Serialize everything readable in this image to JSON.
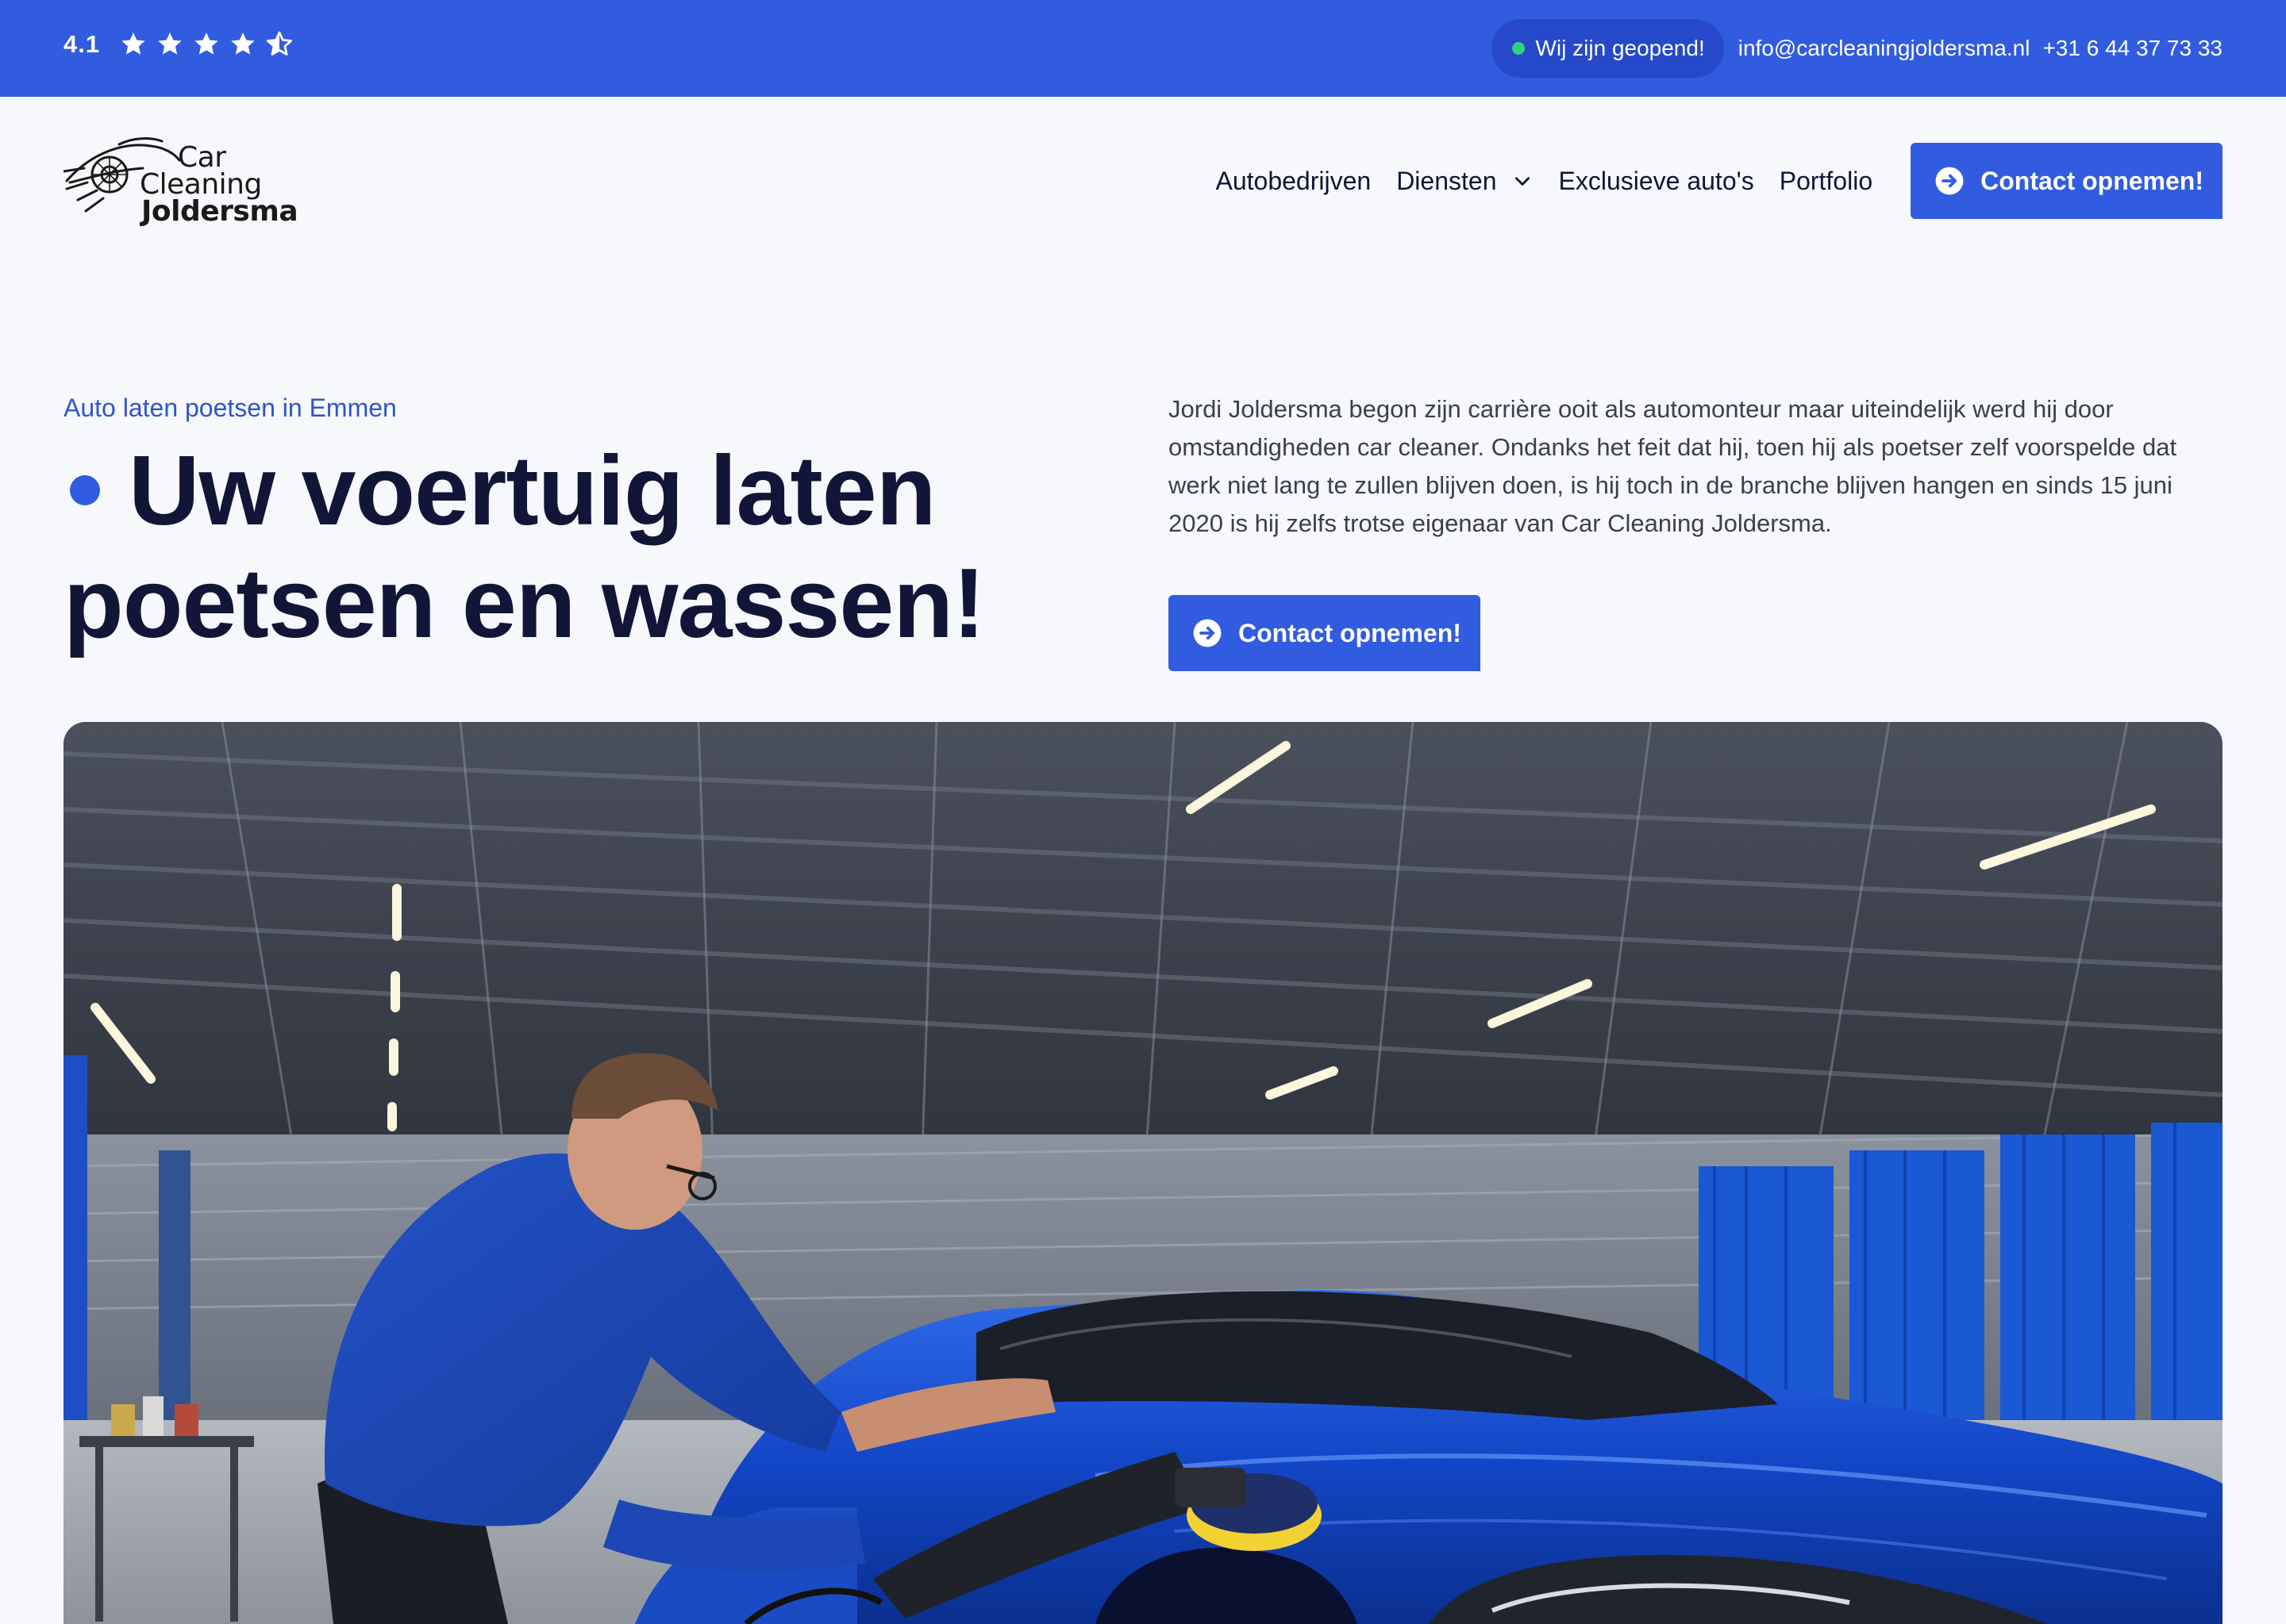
{
  "topbar": {
    "rating_value": "4.1",
    "rating_stars": 4.5,
    "status_text": "Wij zijn geopend!",
    "status_color": "#35d07f",
    "email": "info@carcleaningjoldersma.nl",
    "phone": "+31 6 44 37 73 33"
  },
  "brand": {
    "line1": "Car",
    "line2": "Cleaning",
    "line3": "Joldersma"
  },
  "nav": {
    "items": [
      {
        "label": "Autobedrijven"
      },
      {
        "label": "Diensten",
        "icon": "chevron-down-icon"
      },
      {
        "label": "Exclusieve auto's"
      },
      {
        "label": "Portfolio"
      }
    ],
    "cta_label": "Contact opnemen!",
    "cta_icon": "arrow-right-circle-icon"
  },
  "hero": {
    "kicker": "Auto laten poetsen in Emmen",
    "title": "Uw voertuig laten poetsen en wassen!",
    "description": "Jordi Joldersma begon zijn carrière ooit als automonteur maar uiteindelijk werd hij door omstandigheden car cleaner. Ondanks het feit dat hij, toen hij als poetser zelf voorspelde dat werk niet lang te zullen blijven doen, is hij toch in de branche blijven hangen en sinds 15 juni 2020 is hij zelfs trotse eigenaar van Car Cleaning Joldersma.",
    "cta_label": "Contact opnemen!",
    "cta_icon": "arrow-right-circle-icon"
  },
  "colors": {
    "brand_blue": "#325ce0",
    "dark_text": "#111638",
    "page_bg": "#f7f8fc"
  }
}
